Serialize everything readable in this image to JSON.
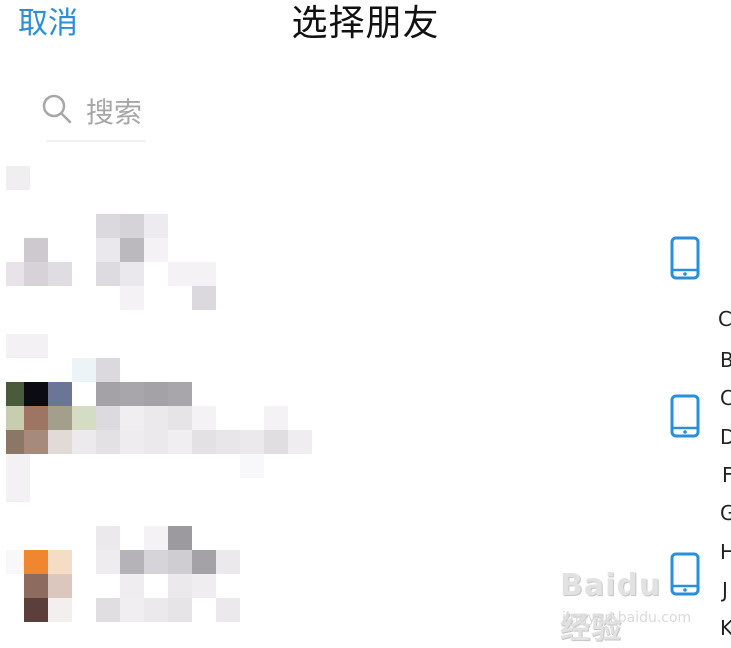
{
  "nav": {
    "cancel_label": "取消",
    "title": "选择朋友"
  },
  "search": {
    "placeholder": "搜索"
  },
  "index_letters": [
    "C",
    "B",
    "C",
    "D",
    "F",
    "G",
    "H",
    "J",
    "K"
  ],
  "contacts": [
    {
      "avatar_colors": [
        "#d8d4da",
        "#cdc9ce",
        "#e6e2e8"
      ],
      "device": "phone-icon"
    },
    {
      "avatar_colors": [
        "#4a5b3c",
        "#0b0c12",
        "#6b7696",
        "#b9a79a",
        "#9d7562",
        "#a68a7c"
      ],
      "device": "phone-icon"
    },
    {
      "avatar_colors": [
        "#f0862f",
        "#f5dcc4",
        "#8d6c5f",
        "#dcc7bf",
        "#5b3f3a"
      ],
      "device": "phone-icon"
    }
  ],
  "watermark": {
    "brand": "Baidu 经验",
    "sub": "jingyan.baidu.com"
  },
  "colors": {
    "accent": "#2a8fd8",
    "title": "#111111",
    "placeholder": "#a7a7a7"
  }
}
